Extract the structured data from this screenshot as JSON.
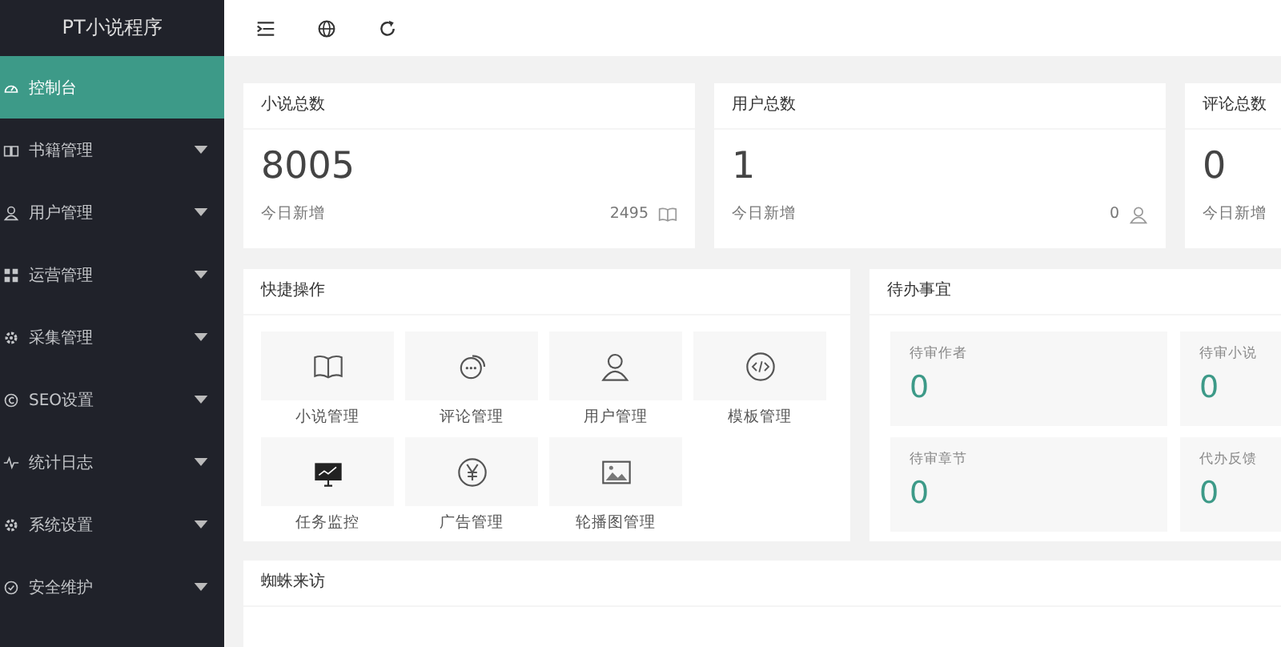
{
  "sidebar": {
    "title": "PT小说程序",
    "items": [
      {
        "label": "控制台",
        "selected": true,
        "has_submenu": false
      },
      {
        "label": "书籍管理",
        "selected": false,
        "has_submenu": true
      },
      {
        "label": "用户管理",
        "selected": false,
        "has_submenu": true
      },
      {
        "label": "运营管理",
        "selected": false,
        "has_submenu": true
      },
      {
        "label": "采集管理",
        "selected": false,
        "has_submenu": true
      },
      {
        "label": "SEO设置",
        "selected": false,
        "has_submenu": true
      },
      {
        "label": "统计日志",
        "selected": false,
        "has_submenu": true
      },
      {
        "label": "系统设置",
        "selected": false,
        "has_submenu": true
      },
      {
        "label": "安全维护",
        "selected": false,
        "has_submenu": true
      }
    ]
  },
  "stats": [
    {
      "title": "小说总数",
      "value": "8005",
      "sub_label": "今日新增",
      "sub_value": "2495"
    },
    {
      "title": "用户总数",
      "value": "1",
      "sub_label": "今日新增",
      "sub_value": "0"
    },
    {
      "title": "评论总数",
      "value": "0",
      "sub_label": "今日新增"
    }
  ],
  "quick_actions": {
    "title": "快捷操作",
    "items": [
      {
        "label": "小说管理"
      },
      {
        "label": "评论管理"
      },
      {
        "label": "用户管理"
      },
      {
        "label": "模板管理"
      },
      {
        "label": "任务监控"
      },
      {
        "label": "广告管理"
      },
      {
        "label": "轮播图管理"
      }
    ]
  },
  "todo": {
    "title": "待办事宜",
    "items": [
      {
        "label": "待审作者",
        "value": "0"
      },
      {
        "label": "待审小说",
        "value": "0"
      },
      {
        "label": "待审章节",
        "value": "0"
      },
      {
        "label": "代办反馈",
        "value": "0"
      }
    ]
  },
  "visits": {
    "title": "蜘蛛来访"
  }
}
